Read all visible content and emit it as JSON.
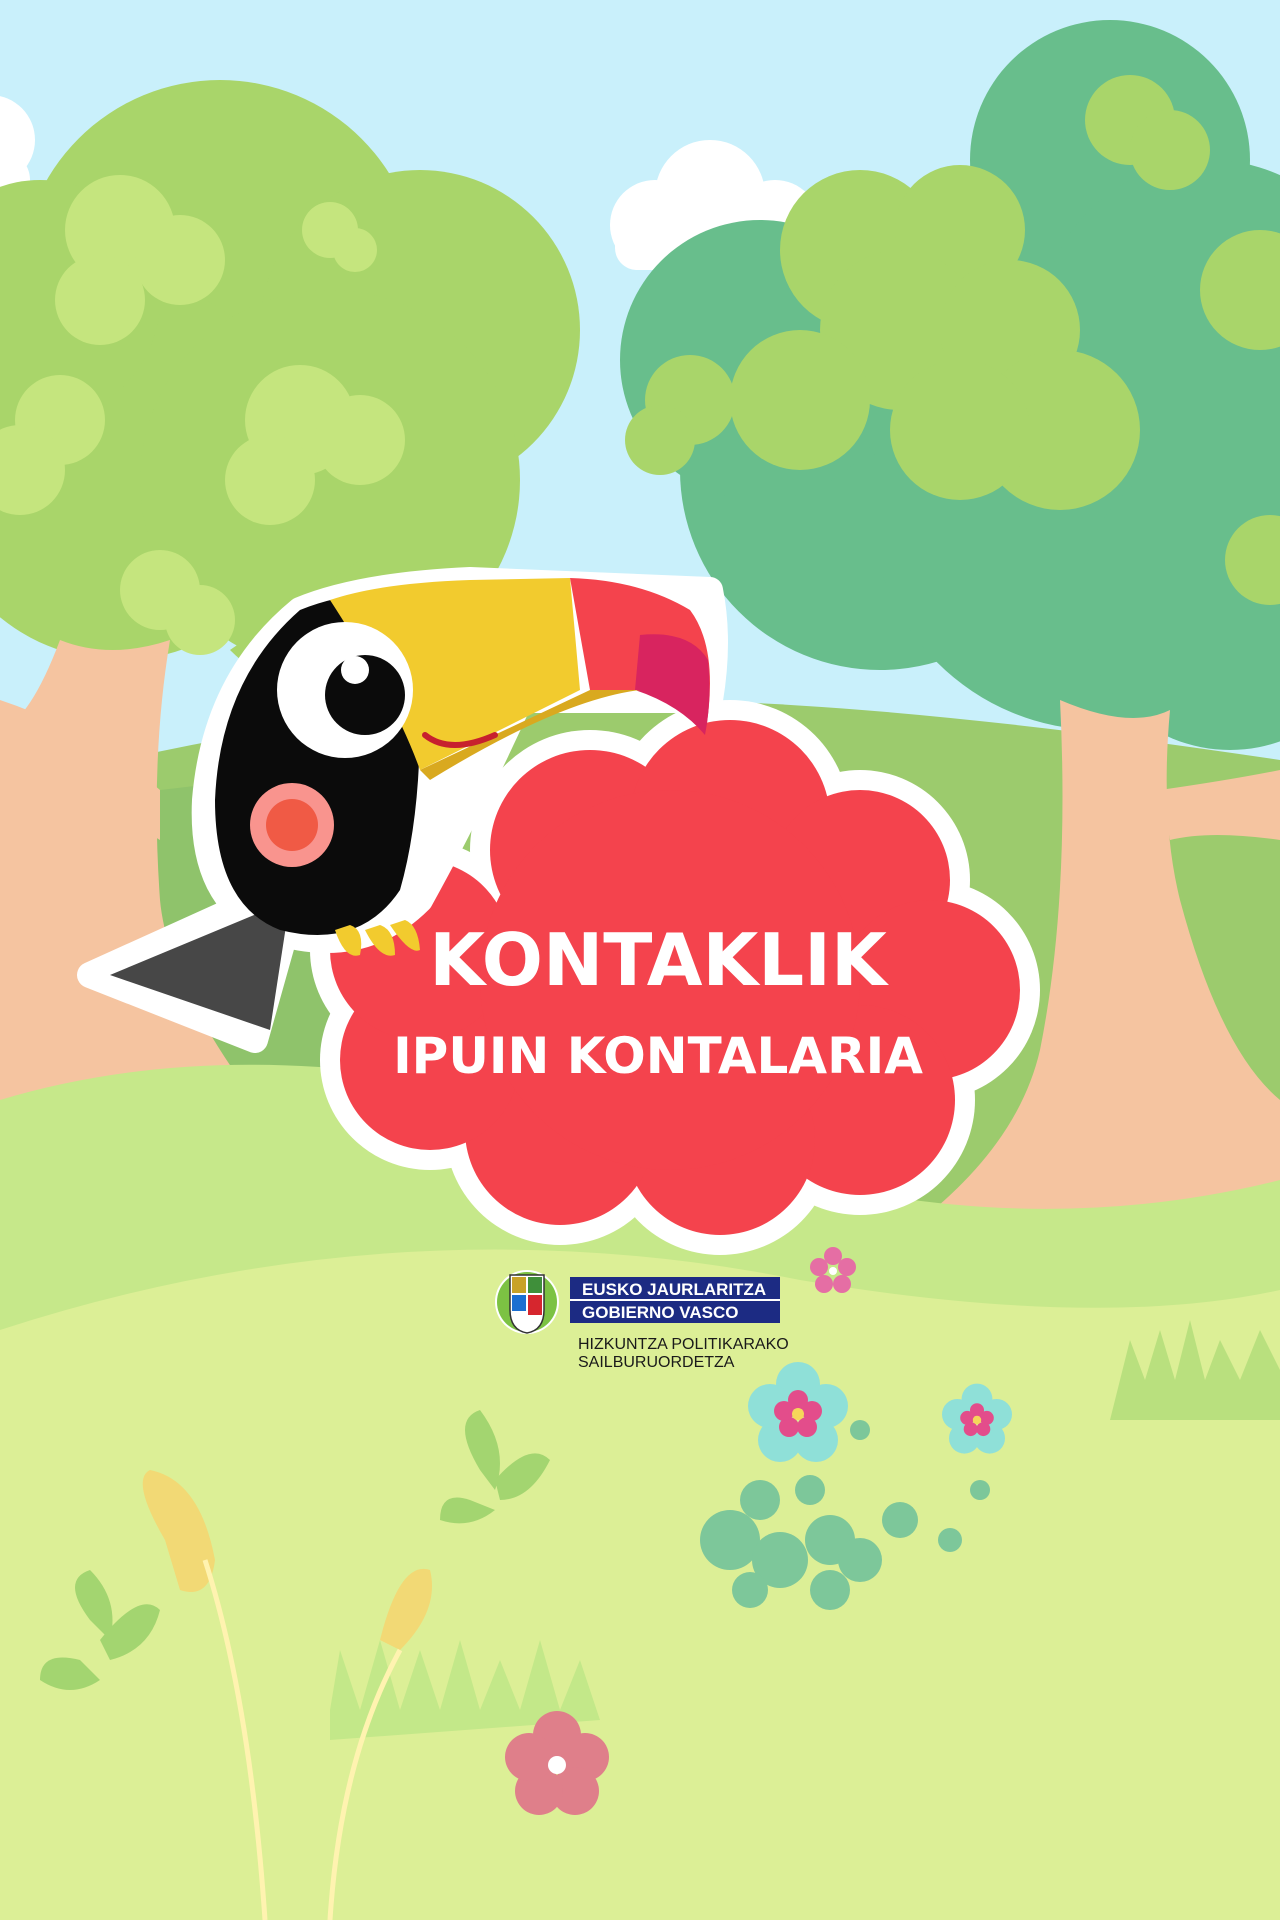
{
  "app": {
    "title_line1": "KONTAKLIK",
    "title_line2": "IPUIN KONTALARIA"
  },
  "government": {
    "line1": "EUSKO JAURLARITZA",
    "line2": "GOBIERNO VASCO",
    "dept_line1": "HIZKUNTZA POLITIKARAKO",
    "dept_line2": "SAILBURUORDETZA"
  },
  "colors": {
    "sky": "#c9f0fb",
    "cloud_bubble": "#f4434d",
    "toucan_body": "#000000",
    "beak_yellow": "#f2cb2e",
    "beak_red": "#f4434d",
    "beak_tip": "#d8245f",
    "logo_blue": "#1c2b83",
    "grass_light": "#dcef96",
    "tree_light": "#a9d56a",
    "tree_dark": "#68be8c",
    "trunk": "#f5c4a0"
  },
  "icons": {
    "mascot": "toucan-icon",
    "crest": "basque-crest-icon",
    "flowers": "flower-icon"
  }
}
